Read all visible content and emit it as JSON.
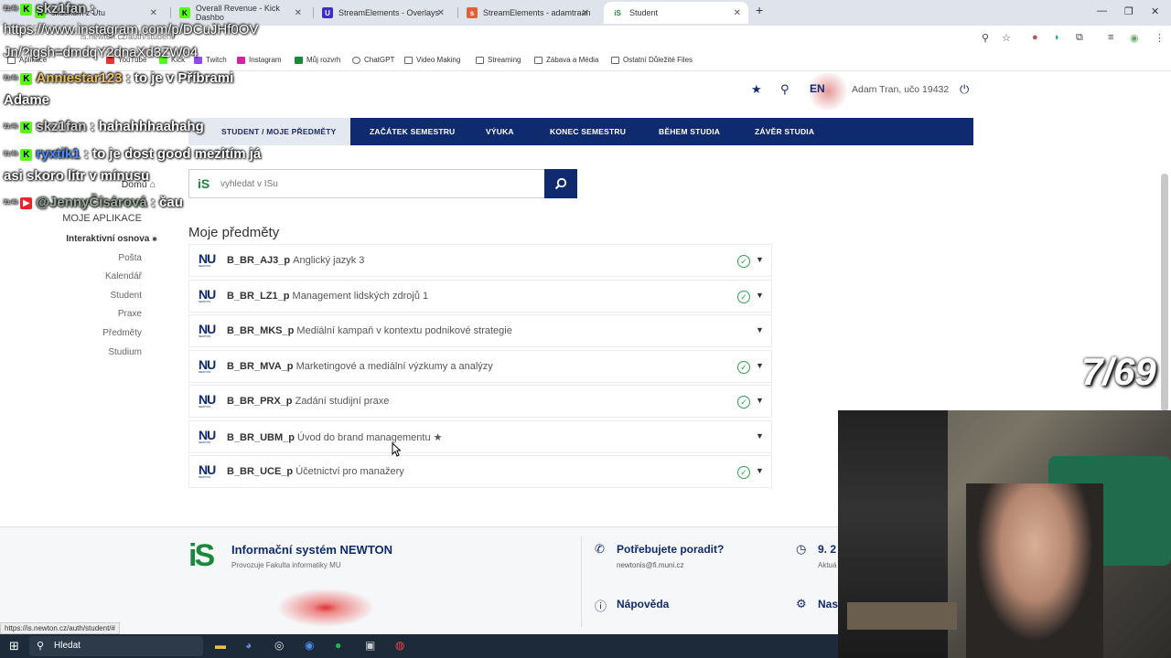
{
  "browser": {
    "tabs": [
      {
        "label": "skůškům z Útu",
        "fav": "K"
      },
      {
        "label": "Overall Revenue - Kick Dashbo",
        "fav": "K"
      },
      {
        "label": "StreamElements - Overlays",
        "fav": "U"
      },
      {
        "label": "StreamElements - adamtraan",
        "fav": "s"
      },
      {
        "label": "Student",
        "fav": "iS"
      }
    ],
    "url": "is.newton.cz/auth/student/",
    "bookmarks": [
      "Aplikace",
      "YouTube",
      "Kick",
      "Twitch",
      "Instagram",
      "Můj rozvrh",
      "ChatGPT",
      "Video Making",
      "Streaming",
      "Zábava a Média",
      "Ostatní Důležité Files"
    ],
    "status_url": "https://is.newton.cz/auth/student/#"
  },
  "header": {
    "lang": "EN",
    "user": "Adam Tran, učo 19432"
  },
  "nav": [
    "STUDENT / MOJE PŘEDMĚTY",
    "ZAČÁTEK SEMESTRU",
    "VÝUKA",
    "KONEC SEMESTRU",
    "BĚHEM STUDIA",
    "ZÁVĚR STUDIA"
  ],
  "search": {
    "placeholder": "vyhledat v ISu"
  },
  "sidebar": {
    "home": "Domů",
    "apps_title": "MOJE APLIKACE",
    "items": [
      "Interaktivní osnova",
      "Pošta",
      "Kalendář",
      "Student",
      "Praxe",
      "Předměty",
      "Studium"
    ]
  },
  "main": {
    "title": "Moje předměty",
    "courses": [
      {
        "code": "B_BR_AJ3_p",
        "name": "Anglický jazyk 3",
        "check": true
      },
      {
        "code": "B_BR_LZ1_p",
        "name": "Management lidských zdrojů 1",
        "check": true
      },
      {
        "code": "B_BR_MKS_p",
        "name": "Mediální kampaň v kontextu podnikové strategie",
        "check": false
      },
      {
        "code": "B_BR_MVA_p",
        "name": "Marketingové a mediální výzkumy a analýzy",
        "check": true
      },
      {
        "code": "B_BR_PRX_p",
        "name": "Zadání studijní praxe",
        "check": true
      },
      {
        "code": "B_BR_UBM_p",
        "name": "Úvod do brand managementu ★",
        "check": false
      },
      {
        "code": "B_BR_UCE_p",
        "name": "Účetnictví pro manažery",
        "check": true
      }
    ],
    "logo_text": "NU",
    "logo_sub": "NEWTON"
  },
  "footer": {
    "title": "Informační systém NEWTON",
    "subtitle": "Provozuje Fakulta informatiky MU",
    "help_title": "Potřebujete poradit?",
    "help_email": "newtonis@fi.muni.cz",
    "napoveda": "Nápověda",
    "date_partial": "9. 2",
    "date_sub": "Aktuá",
    "settings_partial": "Nas"
  },
  "taskbar": {
    "search": "Hledat"
  },
  "overlay": {
    "counter": "7/69",
    "chat": [
      {
        "nick": "skz1fan",
        "msg": ":"
      },
      {
        "nick": "",
        "msg": "https://www.instagram.com/p/DCuJHf0OV"
      },
      {
        "nick": "",
        "msg": "Jn/?igsh=dmdqY2dnaXd3ZW04"
      },
      {
        "nick": "Anniestar123",
        "msg": ": to je v Příbrami"
      },
      {
        "nick": "",
        "msg": "Adame"
      },
      {
        "nick": "skz1fan",
        "msg": ": hahahhhaahahg"
      },
      {
        "nick": "ryxtik1",
        "msg": ": to je dost good mezitím já"
      },
      {
        "nick": "",
        "msg": "asi skoro litr v mínusu"
      },
      {
        "nick": "@JennyČísárová",
        "msg": ": čau"
      }
    ]
  },
  "colors": {
    "navy": "#0f2a6e",
    "green": "#2aa44f",
    "kick": "#53fc18"
  }
}
